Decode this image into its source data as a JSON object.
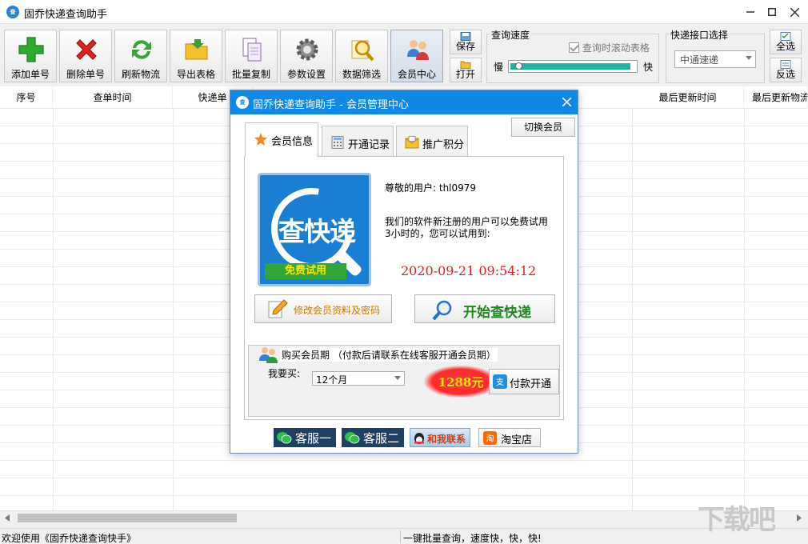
{
  "window": {
    "title": "固乔快递查询助手",
    "app_icon_text": "查"
  },
  "toolbar": {
    "buttons": [
      {
        "label": "添加单号",
        "icon": "plus-icon"
      },
      {
        "label": "删除单号",
        "icon": "delete-x-icon"
      },
      {
        "label": "刷新物流",
        "icon": "refresh-icon"
      },
      {
        "label": "导出表格",
        "icon": "folder-export-icon"
      },
      {
        "label": "批量复制",
        "icon": "copy-icon"
      },
      {
        "label": "参数设置",
        "icon": "gear-icon"
      },
      {
        "label": "数据筛选",
        "icon": "magnifier-icon"
      },
      {
        "label": "会员中心",
        "icon": "members-icon"
      }
    ],
    "save_label": "保存",
    "open_label": "打开",
    "speed": {
      "title": "查询速度",
      "scroll_checkbox_label": "查询时滚动表格",
      "slow_label": "慢",
      "fast_label": "快",
      "level": 0.04
    },
    "interface": {
      "title": "快递接口选择",
      "selected": "中通速递"
    },
    "select_all_label": "全选",
    "invert_label": "反选"
  },
  "table": {
    "columns": [
      "序号",
      "查单时间",
      "快递单",
      "最后更新时间",
      "最后更新物流"
    ]
  },
  "status": {
    "left": "欢迎使用《固乔快递查询快手》",
    "right": "一键批量查询，速度快，快，快!"
  },
  "dialog": {
    "title": "固乔快递查询助手 - 会员管理中心",
    "switch_member_label": "切换会员",
    "tabs": [
      {
        "label": "会员信息",
        "icon": "star-icon"
      },
      {
        "label": "开通记录",
        "icon": "calculator-icon"
      },
      {
        "label": "推广积分",
        "icon": "mail-icon"
      }
    ],
    "logo": {
      "word": "查快递",
      "ribbon": "免费试用"
    },
    "user_line": "尊敬的用户: thl0979",
    "trial_line1": "我们的软件新注册的用户可以免费试用",
    "trial_line2": "3小时的，您可以试用到:",
    "expire_time": "2020-09-21 09:54:12",
    "edit_profile_label": "修改会员资料及密码",
    "start_label": "开始查快递",
    "purchase": {
      "title": "购买会员期 （付款后请联系在线客服开通会员期）",
      "buy_label": "我要买:",
      "period": "12个月",
      "price": "1288元",
      "pay_label": "付款开通"
    },
    "footer": {
      "service1": "客服一",
      "service2": "客服二",
      "contact": "和我联系",
      "taobao": "淘宝店"
    }
  },
  "watermark": "下载吧"
}
